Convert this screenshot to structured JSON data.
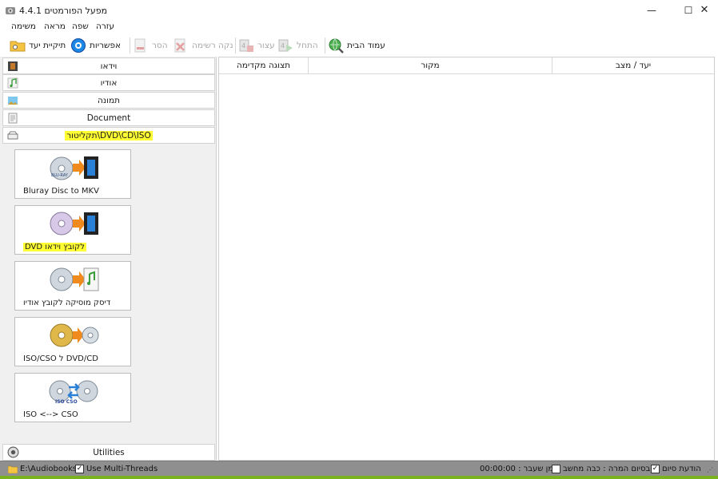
{
  "window": {
    "title": "4.4.1 מפעל הפורמטים"
  },
  "menu": [
    "עזרה",
    "שפה",
    "מראה",
    "משימה"
  ],
  "toolbar": {
    "home": "עמוד הבית",
    "start": "התחל",
    "stop": "עצור",
    "clear": "נקה רשימה",
    "remove": "הסר",
    "options": "אפשריות",
    "output_folder": "תיקיית יעד"
  },
  "categories": [
    "וידאו",
    "אודיו",
    "תמונה",
    "Document",
    "תקליטור\\DVD\\CD\\ISO"
  ],
  "tiles": [
    {
      "label": "Bluray Disc to MKV",
      "gfx_text": "BLU-RAY"
    },
    {
      "label": "DVD לקובץ וידאו",
      "gfx_text": ""
    },
    {
      "label": "דיסק מוסיקה לקובץ אודיו",
      "gfx_text": ""
    },
    {
      "label": "ISO/CSO ל DVD/CD",
      "gfx_text": ""
    },
    {
      "label": "ISO <--> CSO",
      "gfx_text": "ISO CSO"
    }
  ],
  "utilities": "Utilities",
  "columns": {
    "preview": "תצוגה מקדימה",
    "source": "מקור",
    "target": "יעד / מצב"
  },
  "status": {
    "path": "E:\\Audiobooks",
    "multithreads": "Use Multi-Threads",
    "notify": "הודעת סיום",
    "shutdown": "בסיום המרה : כבה מחשב",
    "elapsed": "00:00:00 : זמן שעבר"
  },
  "colors": {
    "highlight": "#ffff33",
    "status_bg": "#8f8f8f",
    "accent_green": "#7bb31f"
  }
}
